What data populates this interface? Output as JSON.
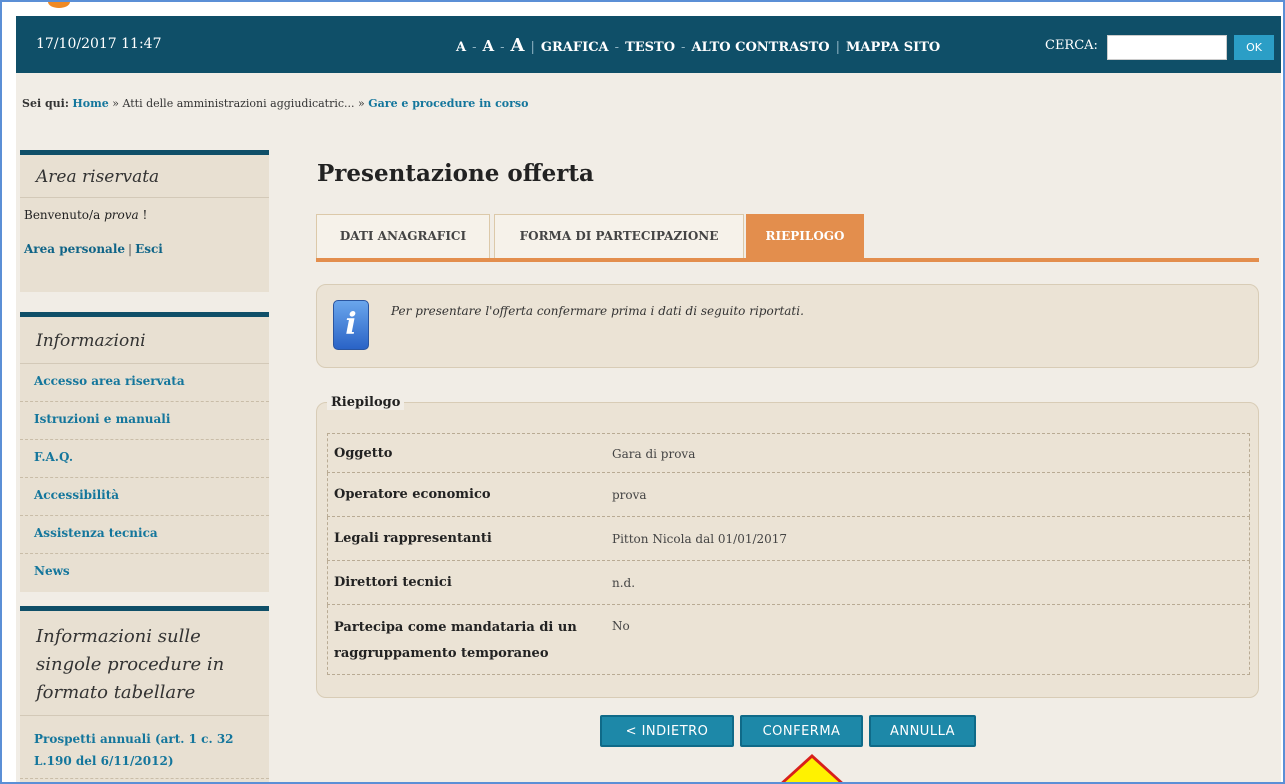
{
  "header": {
    "datetime": "17/10/2017 11:47",
    "font_small": "A",
    "font_medium": "A",
    "font_large": "A",
    "sep_dash": "-",
    "sep_pipe": "|",
    "grafica": "GRAFICA",
    "testo": "TESTO",
    "alto_contrasto": "ALTO CONTRASTO",
    "mappa_sito": "MAPPA SITO",
    "search_label": "CERCA:",
    "search_value": "",
    "ok_label": "OK"
  },
  "breadcrumb": {
    "prefix": "Sei qui:",
    "home": "Home",
    "sep": "»",
    "middle": "Atti delle amministrazioni aggiudicatric...",
    "current": "Gare e procedure in corso"
  },
  "sidebar": {
    "area_riservata": {
      "title": "Area riservata",
      "welcome_prefix": "Benvenuto/a",
      "username": "prova",
      "welcome_suffix": "!",
      "area_personale": "Area personale",
      "pipe": "|",
      "esci": "Esci"
    },
    "informazioni": {
      "title": "Informazioni",
      "items": [
        {
          "label": "Accesso area riservata"
        },
        {
          "label": "Istruzioni e manuali"
        },
        {
          "label": "F.A.Q."
        },
        {
          "label": "Accessibilità"
        },
        {
          "label": "Assistenza tecnica"
        },
        {
          "label": "News"
        }
      ]
    },
    "procedure": {
      "title": "Informazioni sulle singole procedure in formato tabellare",
      "items": [
        {
          "label": "Prospetti annuali (art. 1 c. 32 L.190 del 6/11/2012)"
        }
      ]
    }
  },
  "main": {
    "title": "Presentazione offerta",
    "tabs": [
      {
        "label": "DATI ANAGRAFICI",
        "active": false
      },
      {
        "label": "FORMA DI PARTECIPAZIONE",
        "active": false
      },
      {
        "label": "RIEPILOGO",
        "active": true
      }
    ],
    "info_message": "Per presentare l'offerta confermare prima i dati di seguito riportati.",
    "info_icon_glyph": "i",
    "summary_title": "Riepilogo",
    "summary_rows": [
      {
        "key": "Oggetto",
        "value": "Gara di prova"
      },
      {
        "key": "Operatore economico",
        "value": "prova"
      },
      {
        "key": "Legali rappresentanti",
        "value": "Pitton Nicola dal 01/01/2017"
      },
      {
        "key": "Direttori tecnici",
        "value": "n.d."
      },
      {
        "key": "Partecipa come mandataria di un raggruppamento temporaneo",
        "value": "No"
      }
    ],
    "buttons": {
      "back": "< INDIETRO",
      "confirm": "CONFERMA",
      "cancel": "ANNULLA"
    }
  },
  "colors": {
    "header_bg": "#0f4f68",
    "accent_orange": "#e38e4d",
    "button_blue": "#1d88a8",
    "link_blue": "#14769c",
    "annotation_arrow": "#fff200"
  }
}
